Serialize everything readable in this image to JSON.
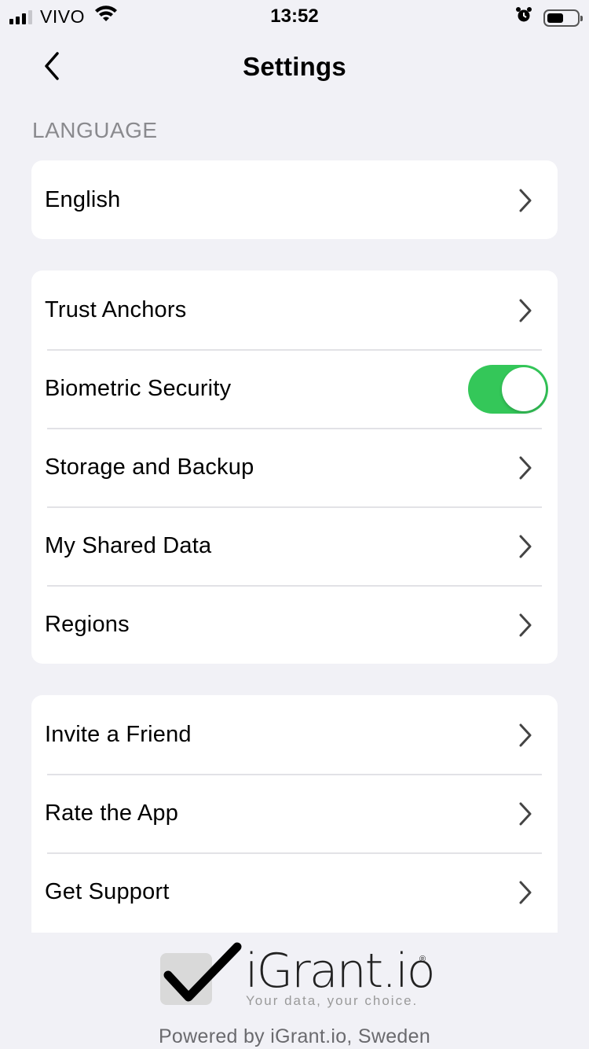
{
  "status_bar": {
    "carrier": "VIVO",
    "time": "13:52"
  },
  "nav": {
    "title": "Settings"
  },
  "language_section": {
    "header": "LANGUAGE",
    "items": [
      {
        "label": "English"
      }
    ]
  },
  "general_group": {
    "items": [
      {
        "label": "Trust Anchors"
      },
      {
        "label": "Biometric Security",
        "toggle": true
      },
      {
        "label": "Storage and Backup"
      },
      {
        "label": "My Shared Data"
      },
      {
        "label": "Regions"
      }
    ]
  },
  "misc_group": {
    "items": [
      {
        "label": "Invite a Friend"
      },
      {
        "label": "Rate the App"
      },
      {
        "label": "Get Support"
      }
    ]
  },
  "footer": {
    "brand": "iGrant.io",
    "registered": "®",
    "tagline": "Your data, your choice.",
    "powered_by": "Powered by iGrant.io, Sweden"
  },
  "colors": {
    "background": "#f1f1f6",
    "toggle_on": "#34c759",
    "section_header": "#8a8a8e"
  }
}
